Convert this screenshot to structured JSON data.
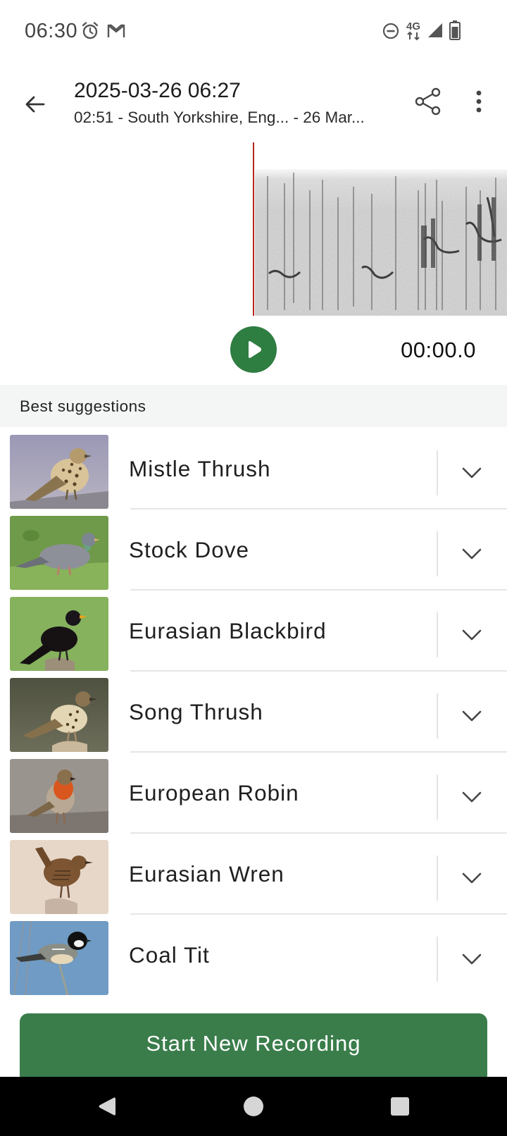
{
  "status_bar": {
    "time": "06:30",
    "left_icons": [
      "alarm-icon",
      "gmail-icon"
    ],
    "right_icons": [
      "do-not-disturb-icon",
      "4g-data-icon",
      "signal-icon",
      "battery-icon"
    ],
    "network_label": "4G"
  },
  "app_bar": {
    "title": "2025-03-26 06:27",
    "subtitle": "02:51 - South Yorkshire, Eng... - 26 Mar...",
    "back_icon": "arrow-back-icon",
    "share_icon": "share-icon",
    "more_icon": "more-vert-icon"
  },
  "player": {
    "time": "00:00.0",
    "play_icon": "play-icon"
  },
  "suggestions": {
    "header": "Best suggestions",
    "items": [
      {
        "name": "Mistle Thrush",
        "thumb_icon": "mistle-thrush-photo"
      },
      {
        "name": "Stock Dove",
        "thumb_icon": "stock-dove-photo"
      },
      {
        "name": "Eurasian Blackbird",
        "thumb_icon": "eurasian-blackbird-photo"
      },
      {
        "name": "Song Thrush",
        "thumb_icon": "song-thrush-photo"
      },
      {
        "name": "European Robin",
        "thumb_icon": "european-robin-photo"
      },
      {
        "name": "Eurasian Wren",
        "thumb_icon": "eurasian-wren-photo"
      },
      {
        "name": "Coal Tit",
        "thumb_icon": "coal-tit-photo"
      }
    ]
  },
  "cta": {
    "label": "Start New Recording"
  },
  "colors": {
    "accent": "#2e7d41",
    "cta": "#3a7d4b",
    "playhead": "#b3261e",
    "section_bg": "#f4f6f5"
  },
  "nav_bar": {
    "icons": [
      "nav-back-icon",
      "nav-home-icon",
      "nav-recents-icon"
    ]
  }
}
